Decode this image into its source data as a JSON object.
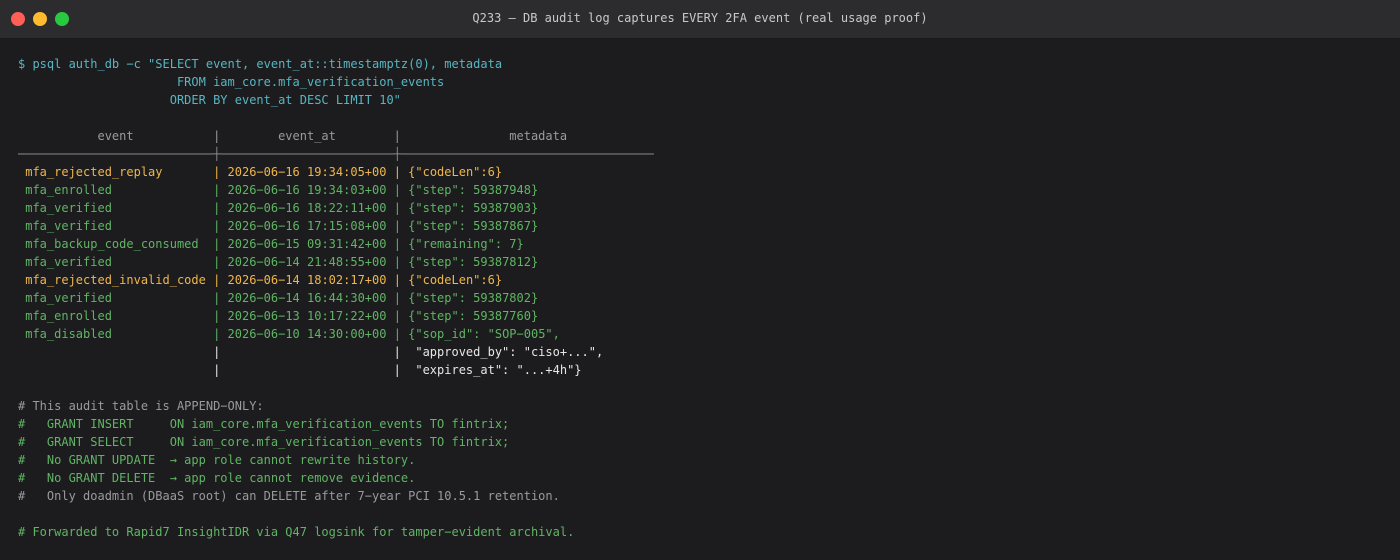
{
  "window": {
    "title": "Q233 — DB audit log captures EVERY 2FA event (real usage proof)"
  },
  "terminal": {
    "command": [
      "$ psql auth_db −c \"SELECT event, event_at::timestamptz(0), metadata",
      "                      FROM iam_core.mfa_verification_events",
      "                     ORDER BY event_at DESC LIMIT 10\""
    ],
    "header": "           event           |        event_at        |               metadata",
    "divider": "───────────────────────────┼────────────────────────┼───────────────────────────────────",
    "rows": [
      {
        "event": " mfa_rejected_replay       ",
        "event_at": " 2026−06−16 19:34:05+00 ",
        "metadata": " {\"codeLen\":6}",
        "color": "orange"
      },
      {
        "event": " mfa_enrolled              ",
        "event_at": " 2026−06−16 19:34:03+00 ",
        "metadata": " {\"step\": 59387948}",
        "color": "green"
      },
      {
        "event": " mfa_verified              ",
        "event_at": " 2026−06−16 18:22:11+00 ",
        "metadata": " {\"step\": 59387903}",
        "color": "green"
      },
      {
        "event": " mfa_verified              ",
        "event_at": " 2026−06−16 17:15:08+00 ",
        "metadata": " {\"step\": 59387867}",
        "color": "green"
      },
      {
        "event": " mfa_backup_code_consumed  ",
        "event_at": " 2026−06−15 09:31:42+00 ",
        "metadata": " {\"remaining\": 7}",
        "color": "green"
      },
      {
        "event": " mfa_verified              ",
        "event_at": " 2026−06−14 21:48:55+00 ",
        "metadata": " {\"step\": 59387812}",
        "color": "green"
      },
      {
        "event": " mfa_rejected_invalid_code ",
        "event_at": " 2026−06−14 18:02:17+00 ",
        "metadata": " {\"codeLen\":6}",
        "color": "orange"
      },
      {
        "event": " mfa_verified              ",
        "event_at": " 2026−06−14 16:44:30+00 ",
        "metadata": " {\"step\": 59387802}",
        "color": "green"
      },
      {
        "event": " mfa_enrolled              ",
        "event_at": " 2026−06−13 10:17:22+00 ",
        "metadata": " {\"step\": 59387760}",
        "color": "green"
      },
      {
        "event": " mfa_disabled              ",
        "event_at": " 2026−06−10 14:30:00+00 ",
        "metadata": " {\"sop_id\": \"SOP−005\",",
        "color": "green"
      }
    ],
    "continuation": [
      "                           |                        |  \"approved_by\": \"ciso+...\",",
      "                           |                        |  \"expires_at\": \"...+4h\"}"
    ],
    "comments": [
      {
        "text": "# This audit table is APPEND−ONLY:",
        "color": "gray"
      },
      {
        "text": "#   GRANT INSERT     ON iam_core.mfa_verification_events TO fintrix;",
        "color": "green"
      },
      {
        "text": "#   GRANT SELECT     ON iam_core.mfa_verification_events TO fintrix;",
        "color": "green"
      },
      {
        "text": "#   No GRANT UPDATE  → app role cannot rewrite history.",
        "color": "green"
      },
      {
        "text": "#   No GRANT DELETE  → app role cannot remove evidence.",
        "color": "green"
      },
      {
        "text": "#   Only doadmin (DBaaS root) can DELETE after 7−year PCI 10.5.1 retention.",
        "color": "gray"
      }
    ],
    "footer": "# Forwarded to Rapid7 InsightIDR via Q47 logsink for tamper−evident archival."
  },
  "colors": {
    "background": "#1c1c1e",
    "titlebar": "#2c2c2e",
    "cyan": "#56b6c2",
    "green": "#5fb563",
    "orange": "#f0b64a",
    "gray": "#9a9a9f",
    "white": "#e6e6e6"
  }
}
